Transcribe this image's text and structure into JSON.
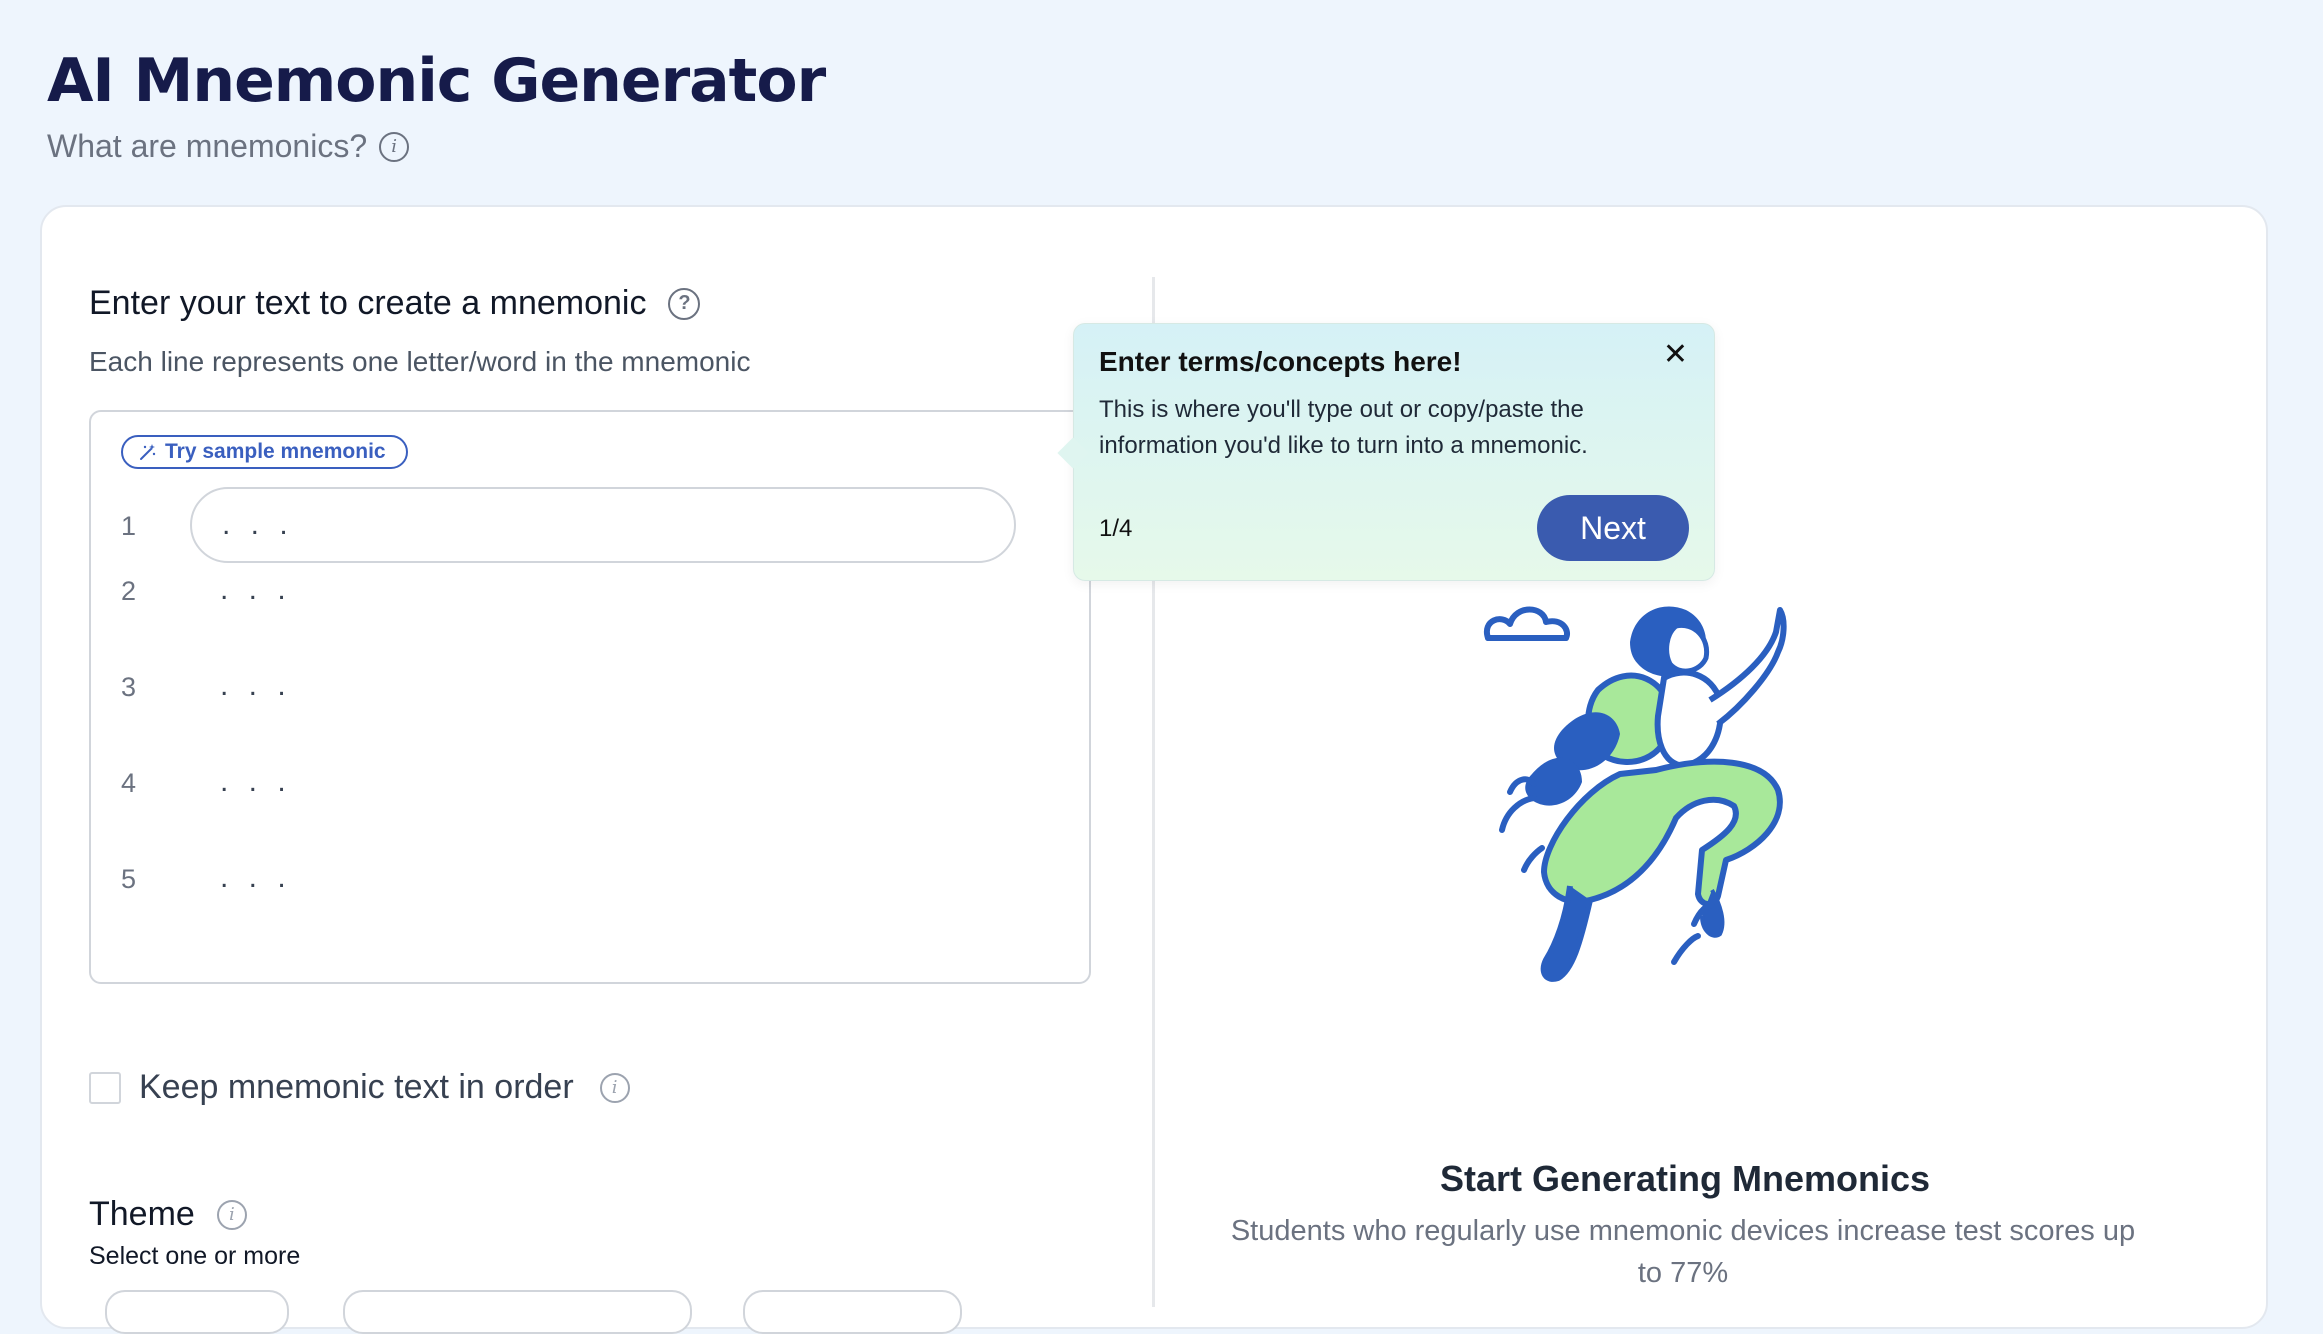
{
  "header": {
    "title": "AI Mnemonic Generator",
    "subtitle": "What are mnemonics?"
  },
  "input_section": {
    "title": "Enter your text to create a mnemonic",
    "hint": "Each line represents one letter/word in the mnemonic",
    "sample_button": "Try sample mnemonic",
    "lines": [
      {
        "number": "1",
        "placeholder": ". . ."
      },
      {
        "number": "2",
        "placeholder": ". . ."
      },
      {
        "number": "3",
        "placeholder": ". . ."
      },
      {
        "number": "4",
        "placeholder": ". . ."
      },
      {
        "number": "5",
        "placeholder": ". . ."
      }
    ]
  },
  "options": {
    "keep_order_label": "Keep mnemonic text in order",
    "keep_order_checked": false
  },
  "theme": {
    "title": "Theme",
    "hint": "Select one or more"
  },
  "tooltip": {
    "title": "Enter terms/concepts here!",
    "body": "This is where you'll type out or copy/paste the information you'd like to turn into a mnemonic.",
    "step": "1/4",
    "next_label": "Next"
  },
  "empty_state": {
    "title": "Start Generating Mnemonics",
    "description": "Students who regularly use mnemonic devices increase test scores up to 77%"
  },
  "colors": {
    "accent": "#3a5baf",
    "title": "#161b4a",
    "illustration_blue": "#2a5fc0",
    "illustration_green": "#a8e89a"
  }
}
